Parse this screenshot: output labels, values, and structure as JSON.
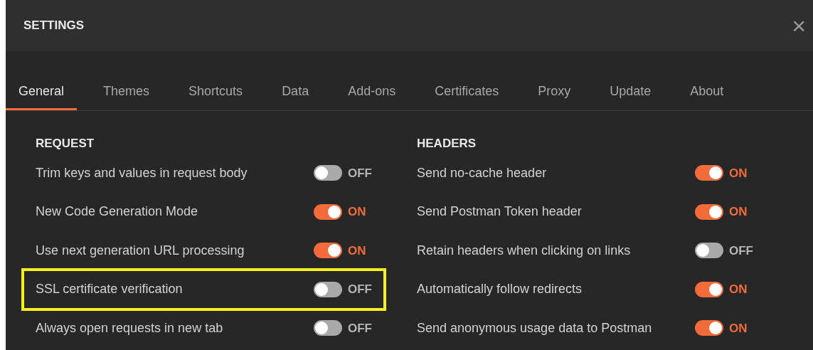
{
  "window": {
    "title": "SETTINGS",
    "close": "×"
  },
  "tabs": [
    {
      "label": "General",
      "selected": true
    },
    {
      "label": "Themes",
      "selected": false
    },
    {
      "label": "Shortcuts",
      "selected": false
    },
    {
      "label": "Data",
      "selected": false
    },
    {
      "label": "Add-ons",
      "selected": false
    },
    {
      "label": "Certificates",
      "selected": false
    },
    {
      "label": "Proxy",
      "selected": false
    },
    {
      "label": "Update",
      "selected": false
    },
    {
      "label": "About",
      "selected": false
    }
  ],
  "sections": [
    {
      "heading": "REQUEST",
      "rows": [
        {
          "label": "Trim keys and values in request body",
          "on": false,
          "state_label": "OFF",
          "highlighted": false
        },
        {
          "label": "New Code Generation Mode",
          "on": true,
          "state_label": "ON",
          "highlighted": false
        },
        {
          "label": "Use next generation URL processing",
          "on": true,
          "state_label": "ON",
          "highlighted": false
        },
        {
          "label": "SSL certificate verification",
          "on": false,
          "state_label": "OFF",
          "highlighted": true
        },
        {
          "label": "Always open requests in new tab",
          "on": false,
          "state_label": "OFF",
          "highlighted": false
        }
      ]
    },
    {
      "heading": "HEADERS",
      "rows": [
        {
          "label": "Send no-cache header",
          "on": true,
          "state_label": "ON",
          "highlighted": false
        },
        {
          "label": "Send Postman Token header",
          "on": true,
          "state_label": "ON",
          "highlighted": false
        },
        {
          "label": "Retain headers when clicking on links",
          "on": false,
          "state_label": "OFF",
          "highlighted": false
        },
        {
          "label": "Automatically follow redirects",
          "on": true,
          "state_label": "ON",
          "highlighted": false
        },
        {
          "label": "Send anonymous usage data to Postman",
          "on": true,
          "state_label": "ON",
          "highlighted": false
        }
      ]
    }
  ]
}
